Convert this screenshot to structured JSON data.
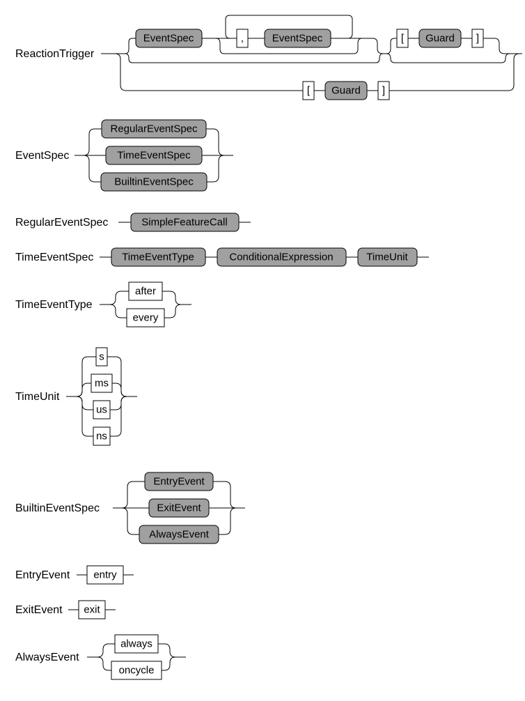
{
  "rules": {
    "ReactionTrigger": {
      "label": "ReactionTrigger",
      "tokens": {
        "EventSpec": "EventSpec",
        "comma": ",",
        "Guard": "Guard",
        "lbrack": "[",
        "rbrack": "]"
      }
    },
    "EventSpec": {
      "label": "EventSpec",
      "tokens": {
        "RegularEventSpec": "RegularEventSpec",
        "TimeEventSpec": "TimeEventSpec",
        "BuiltinEventSpec": "BuiltinEventSpec"
      }
    },
    "RegularEventSpec": {
      "label": "RegularEventSpec",
      "tokens": {
        "SimpleFeatureCall": "SimpleFeatureCall"
      }
    },
    "TimeEventSpec": {
      "label": "TimeEventSpec",
      "tokens": {
        "TimeEventType": "TimeEventType",
        "ConditionalExpression": "ConditionalExpression",
        "TimeUnit": "TimeUnit"
      }
    },
    "TimeEventType": {
      "label": "TimeEventType",
      "tokens": {
        "after": "after",
        "every": "every"
      }
    },
    "TimeUnit": {
      "label": "TimeUnit",
      "tokens": {
        "s": "s",
        "ms": "ms",
        "us": "us",
        "ns": "ns"
      }
    },
    "BuiltinEventSpec": {
      "label": "BuiltinEventSpec",
      "tokens": {
        "EntryEvent": "EntryEvent",
        "ExitEvent": "ExitEvent",
        "AlwaysEvent": "AlwaysEvent"
      }
    },
    "EntryEvent": {
      "label": "EntryEvent",
      "tokens": {
        "entry": "entry"
      }
    },
    "ExitEvent": {
      "label": "ExitEvent",
      "tokens": {
        "exit": "exit"
      }
    },
    "AlwaysEvent": {
      "label": "AlwaysEvent",
      "tokens": {
        "always": "always",
        "oncycle": "oncycle"
      }
    }
  }
}
